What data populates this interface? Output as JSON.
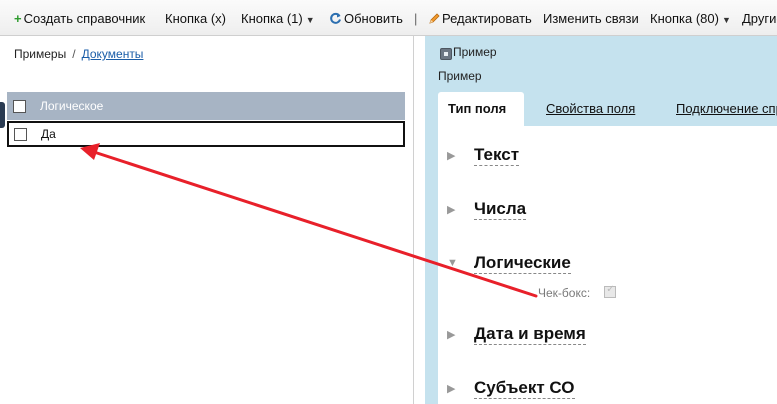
{
  "toolbar": {
    "create_ref": "Создать справочник",
    "button_x": "Кнопка (x)",
    "button_1": "Кнопка (1)",
    "refresh": "Обновить",
    "separator": "|",
    "edit": "Редактировать",
    "change_links": "Изменить связи",
    "button_80": "Кнопка (80)",
    "other": "Другие"
  },
  "breadcrumb": {
    "root": "Примеры",
    "separator": "/",
    "current": "Документы"
  },
  "grid": {
    "column": "Логическое",
    "rows": [
      {
        "value": "Да"
      }
    ]
  },
  "detail": {
    "title": "Пример",
    "subtitle": "Пример",
    "tabs": [
      {
        "label": "Тип поля",
        "active": true
      },
      {
        "label": "Свойства поля"
      },
      {
        "label": "Подключение справочников"
      }
    ],
    "sections": [
      {
        "label": "Текст",
        "expanded": false
      },
      {
        "label": "Числа",
        "expanded": false
      },
      {
        "label": "Логические",
        "expanded": true
      },
      {
        "label": "Дата и время",
        "expanded": false
      },
      {
        "label": "Субъект СО",
        "expanded": false
      }
    ],
    "field": {
      "label": "Чек-бокс:",
      "checked": true
    }
  },
  "colors": {
    "accent_red": "#e8202a",
    "panel_blue": "#c5e2ee",
    "grid_header": "#a7b4c4",
    "link": "#1a5da8"
  },
  "icons": {
    "create": "plus-icon",
    "refresh": "refresh-icon",
    "edit": "pencil-icon",
    "dropdown": "caret-down-icon"
  }
}
